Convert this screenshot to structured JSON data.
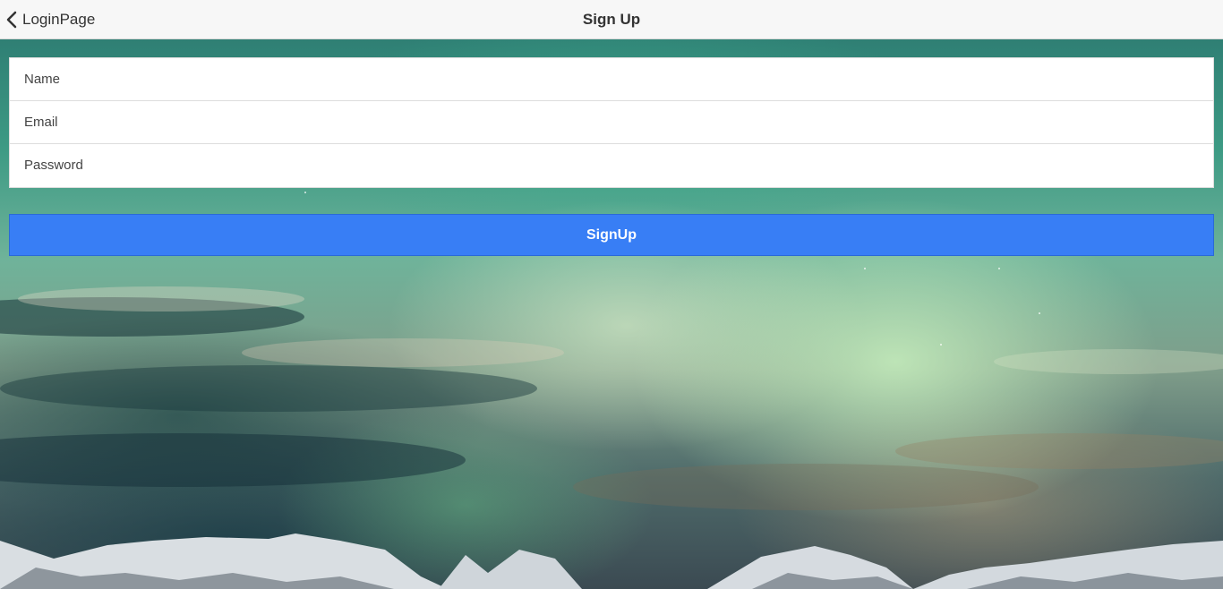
{
  "header": {
    "back_label": "LoginPage",
    "title": "Sign Up"
  },
  "form": {
    "name_placeholder": "Name",
    "email_placeholder": "Email",
    "password_placeholder": "Password"
  },
  "signup_label": "SignUp",
  "colors": {
    "primary": "#387ef5",
    "header_bg": "#f7f7f7"
  },
  "icons": {
    "back": "chevron-left-icon"
  }
}
